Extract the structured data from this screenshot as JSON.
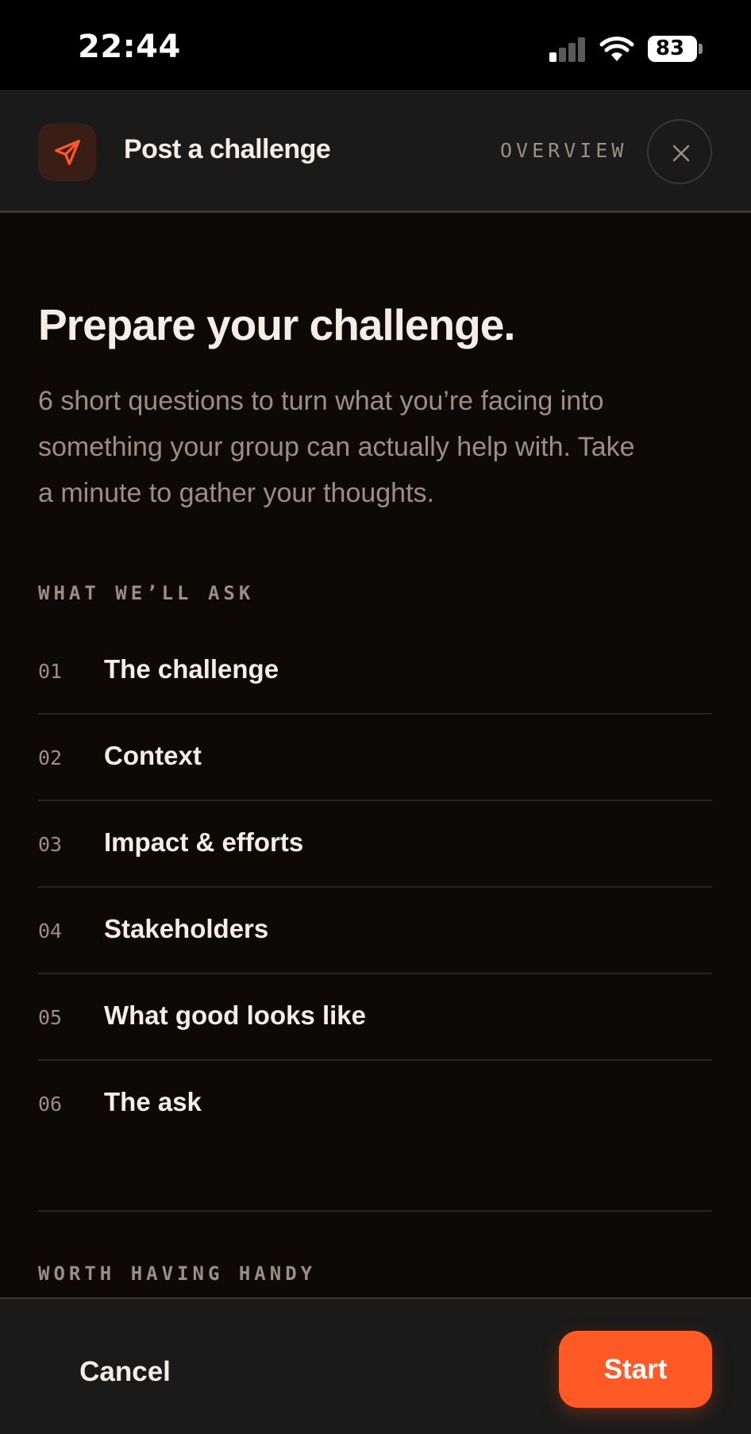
{
  "status_bar": {
    "time": "22:44",
    "battery": "83"
  },
  "header": {
    "title": "Post a challenge",
    "step_label": "OVERVIEW",
    "icon": "send-icon",
    "close_icon": "close-icon"
  },
  "main": {
    "heading": "Prepare your challenge.",
    "subtext": "6 short questions to turn what you’re facing into something your group can actually help with. Take a minute to gather your thoughts.",
    "section_ask": "WHAT WE’LL ASK",
    "questions": [
      {
        "num": "01",
        "label": "The challenge"
      },
      {
        "num": "02",
        "label": "Context"
      },
      {
        "num": "03",
        "label": "Impact & efforts"
      },
      {
        "num": "04",
        "label": "Stakeholders"
      },
      {
        "num": "05",
        "label": "What good looks like"
      },
      {
        "num": "06",
        "label": "The ask"
      }
    ],
    "section_handy": "WORTH HAVING HANDY"
  },
  "footer": {
    "cancel_label": "Cancel",
    "start_label": "Start"
  },
  "colors": {
    "accent": "#ff5a26",
    "background": "#0d0907",
    "surface": "#1a1a1a",
    "muted_text": "#9c8e85"
  }
}
